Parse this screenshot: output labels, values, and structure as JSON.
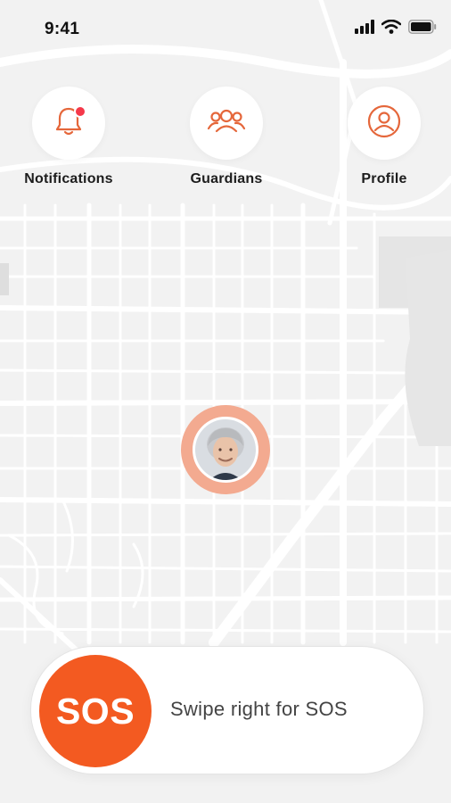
{
  "status_bar": {
    "time": "9:41",
    "icons": [
      "signal-icon",
      "wifi-icon",
      "battery-icon"
    ]
  },
  "nav": [
    {
      "id": "notifications",
      "label": "Notifications",
      "icon": "bell-icon",
      "has_badge": true
    },
    {
      "id": "guardians",
      "label": "Guardians",
      "icon": "group-icon",
      "has_badge": false
    },
    {
      "id": "profile",
      "label": "Profile",
      "icon": "user-icon",
      "has_badge": false
    }
  ],
  "map": {
    "user_marker_icon": "avatar"
  },
  "sos": {
    "button_label": "SOS",
    "hint": "Swipe right for SOS"
  },
  "colors": {
    "accent": "#f35a21",
    "icon_stroke": "#e5673b",
    "ring": "#f3aa90",
    "badge": "#f5384a",
    "map_bg": "#f2f2f2",
    "map_road": "#ffffff"
  }
}
